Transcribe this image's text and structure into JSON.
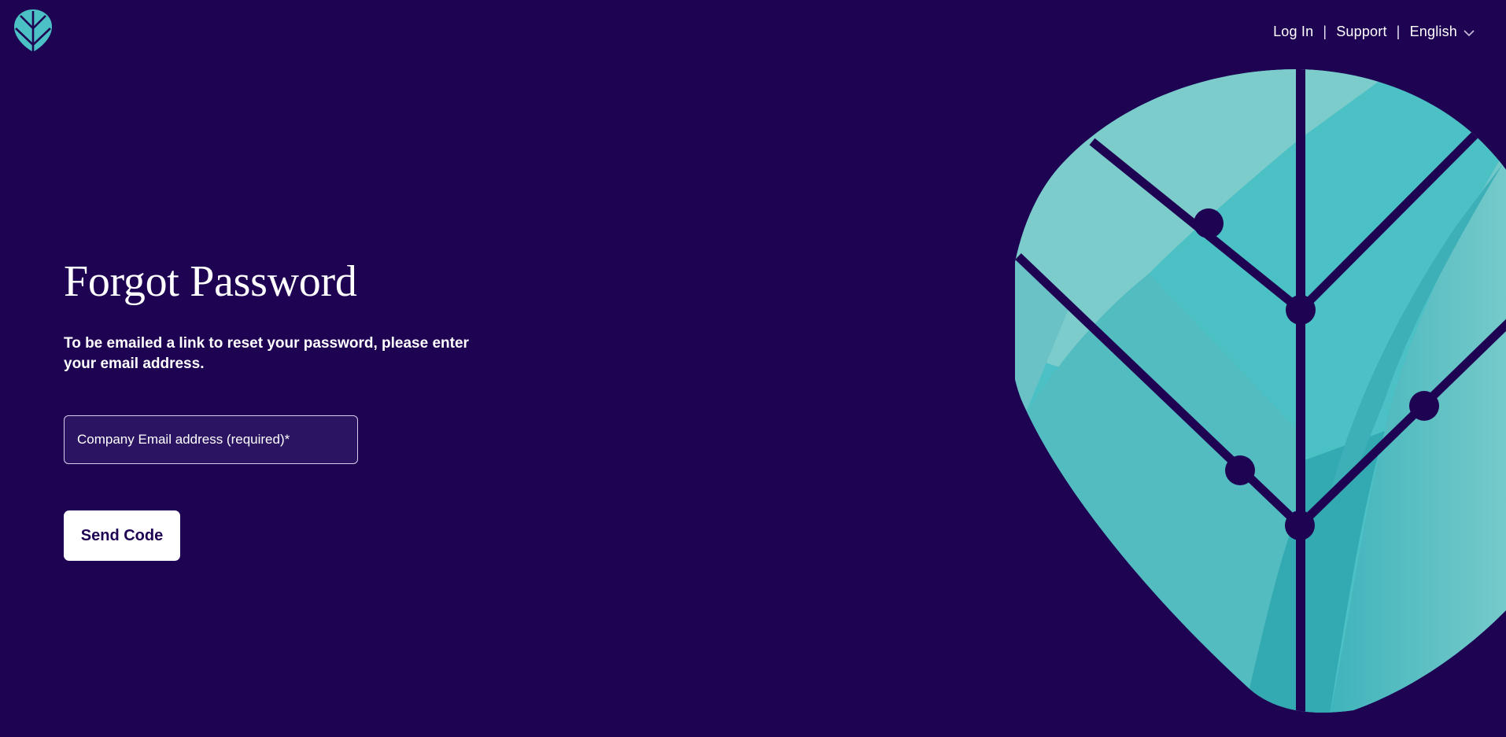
{
  "brand": {
    "logo_icon": "leaf-logo-icon",
    "colors": {
      "background": "#1f0353",
      "accent": "#4bc0c5",
      "accent_light": "#7ccccc",
      "accent_dark": "#2fa8b0",
      "button_bg": "#ffffff",
      "button_text": "#1f0353"
    }
  },
  "nav": {
    "login_label": "Log In",
    "separator": "|",
    "support_label": "Support",
    "language_label": "English",
    "language_icon": "chevron-down-icon"
  },
  "form": {
    "title": "Forgot Password",
    "subtitle": "To be emailed a link to reset your password, please enter your email address.",
    "email_placeholder": "Company Email address (required)*",
    "email_value": "",
    "submit_label": "Send Code"
  },
  "illustration": {
    "icon": "leaf-illustration-icon"
  }
}
